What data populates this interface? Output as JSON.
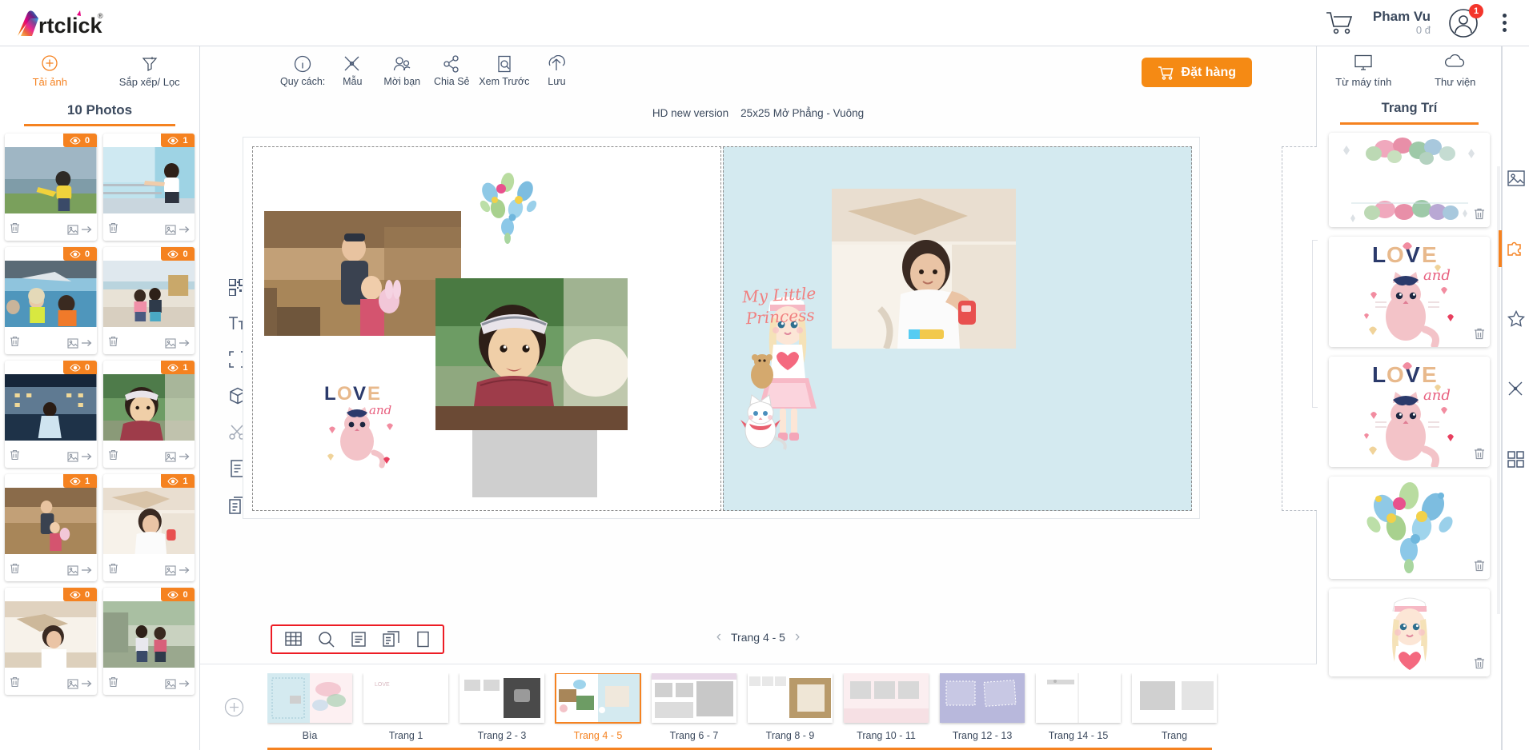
{
  "app": {
    "brand": "Artclick",
    "brand_reg": "®"
  },
  "topbar": {
    "cart_icon": "cart-icon",
    "user_name": "Pham Vu",
    "user_balance": "0 đ",
    "avatar_icon": "avatar-icon",
    "avatar_badge": "1",
    "menu_icon": "kebab-menu-icon"
  },
  "left_panel": {
    "tools": [
      {
        "label": "Tải ảnh",
        "icon": "plus-circle-icon",
        "active": true
      },
      {
        "label": "Sắp xếp/ Lọc",
        "icon": "filter-icon",
        "active": false
      }
    ],
    "photos_title": "10 Photos",
    "photos": [
      {
        "badge": "0",
        "alt": "boy-kicking-by-lake"
      },
      {
        "badge": "1",
        "alt": "girl-at-railing"
      },
      {
        "badge": "0",
        "alt": "kids-on-boat"
      },
      {
        "badge": "0",
        "alt": "two-kids-in-hallway"
      },
      {
        "badge": "0",
        "alt": "girl-in-front-of-resort"
      },
      {
        "badge": "1",
        "alt": "girl-smiling-bandana"
      },
      {
        "badge": "1",
        "alt": "family-on-wooden-stairs"
      },
      {
        "badge": "1",
        "alt": "girl-in-cardboard-box"
      },
      {
        "badge": "0",
        "alt": "child-in-box-closeup"
      },
      {
        "badge": "0",
        "alt": "two-girls-outdoors"
      }
    ],
    "photo_actions": {
      "delete_icon": "trash-icon",
      "move_icon": "image-arrow-icon",
      "eye_icon": "eye-icon"
    }
  },
  "main_toolbar": {
    "items": [
      {
        "label": "Quy cách:",
        "icon": "info-icon"
      },
      {
        "label": "Mẫu",
        "icon": "template-icon"
      },
      {
        "label": "Mời bạn",
        "icon": "invite-friend-icon"
      },
      {
        "label": "Chia Sẻ",
        "icon": "share-icon"
      },
      {
        "label": "Xem Trước",
        "icon": "preview-icon"
      },
      {
        "label": "Lưu",
        "icon": "save-upload-icon"
      }
    ],
    "order_button": "Đặt hàng",
    "order_icon": "cart-icon"
  },
  "canvas": {
    "caption_version": "HD new version",
    "caption_spec": "25x25 Mở Phẳng - Vuông",
    "side_tools": [
      {
        "icon": "qr-code-icon",
        "name": "qr-code-tool"
      },
      {
        "icon": "text-icon",
        "name": "text-tool"
      },
      {
        "icon": "crop-frame-icon",
        "name": "crop-tool"
      },
      {
        "icon": "cube-3d-icon",
        "name": "3d-view-tool"
      },
      {
        "icon": "scissors-icon",
        "name": "cut-tool"
      },
      {
        "icon": "single-page-icon",
        "name": "single-page-tool"
      },
      {
        "icon": "copy-pages-icon",
        "name": "copy-pages-tool"
      }
    ],
    "decor_text": "My Little\nPrincess",
    "page_right_bg": "#d4eaf0"
  },
  "view_tools": [
    {
      "icon": "grid-view-icon",
      "name": "grid-view-button"
    },
    {
      "icon": "zoom-icon",
      "name": "zoom-button"
    },
    {
      "icon": "single-layout-icon",
      "name": "single-layout-button"
    },
    {
      "icon": "duplicate-icon",
      "name": "duplicate-button"
    },
    {
      "icon": "blank-page-icon",
      "name": "blank-page-button"
    }
  ],
  "page_nav": {
    "prev_icon": "chevron-left-icon",
    "label": "Trang 4 - 5",
    "next_icon": "chevron-right-icon"
  },
  "thumbstrip": {
    "add_icon": "plus-circle-icon",
    "pages": [
      {
        "label": "Bìa",
        "active": false,
        "style": "cover"
      },
      {
        "label": "Trang 1",
        "active": false,
        "style": "blank"
      },
      {
        "label": "Trang 2 - 3",
        "active": false,
        "style": "p23"
      },
      {
        "label": "Trang 4 - 5",
        "active": true,
        "style": "p45"
      },
      {
        "label": "Trang 6 - 7",
        "active": false,
        "style": "p67"
      },
      {
        "label": "Trang 8 - 9",
        "active": false,
        "style": "p89"
      },
      {
        "label": "Trang 10 - 11",
        "active": false,
        "style": "p1011"
      },
      {
        "label": "Trang 12 - 13",
        "active": false,
        "style": "p1213"
      },
      {
        "label": "Trang 14 - 15",
        "active": false,
        "style": "p1415"
      },
      {
        "label": "Trang",
        "active": false,
        "style": "p1617"
      }
    ]
  },
  "right_panel": {
    "tools": [
      {
        "label": "Từ máy tính",
        "icon": "desktop-icon"
      },
      {
        "label": "Thư viện",
        "icon": "cloud-icon"
      }
    ],
    "title": "Trang Trí",
    "decorations": [
      {
        "name": "floral-frame-decoration",
        "kind": "floral-frame"
      },
      {
        "name": "love-cat-decoration-1",
        "kind": "love-cat"
      },
      {
        "name": "love-cat-decoration-2",
        "kind": "love-cat"
      },
      {
        "name": "flower-heart-decoration",
        "kind": "flower-heart"
      },
      {
        "name": "princess-girl-decoration",
        "kind": "princess-girl"
      }
    ],
    "rail": [
      {
        "icon": "image-icon",
        "name": "rail-photos",
        "active": false
      },
      {
        "icon": "puzzle-icon",
        "name": "rail-decorations",
        "active": true
      },
      {
        "icon": "star-icon",
        "name": "rail-favorites",
        "active": false
      },
      {
        "icon": "pen-icon",
        "name": "rail-templates",
        "active": false
      },
      {
        "icon": "grid-icon",
        "name": "rail-layouts",
        "active": false
      }
    ]
  },
  "colors": {
    "accent": "#f58220",
    "order_button": "#f58a14",
    "badge_red": "#f4352b",
    "highlight_box": "#ed1c24",
    "page_tint": "#d4eaf0",
    "text": "#3c4a5e"
  }
}
